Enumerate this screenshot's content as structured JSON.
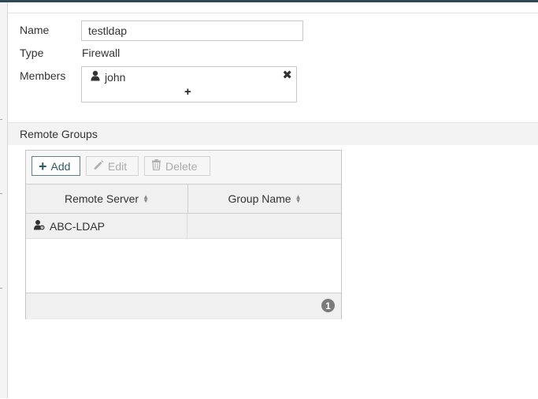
{
  "form": {
    "name_label": "Name",
    "name_value": "testldap",
    "type_label": "Type",
    "type_value": "Firewall",
    "members_label": "Members",
    "members": [
      {
        "name": "john",
        "icon": "user-icon"
      }
    ],
    "add_member_symbol": "+",
    "remove_member_symbol": "✖"
  },
  "remote_groups": {
    "title": "Remote Groups",
    "toolbar": {
      "add_label": "Add",
      "edit_label": "Edit",
      "delete_label": "Delete"
    },
    "columns": [
      "Remote Server",
      "Group Name"
    ],
    "rows": [
      {
        "remote_server": "ABC-LDAP",
        "group_name": "",
        "icon": "ldap-user-icon"
      }
    ],
    "count": "1"
  },
  "colors": {
    "topbar": "#2f4a56",
    "add_button_border": "#5f7f85",
    "badge": "#7b7b7b"
  }
}
